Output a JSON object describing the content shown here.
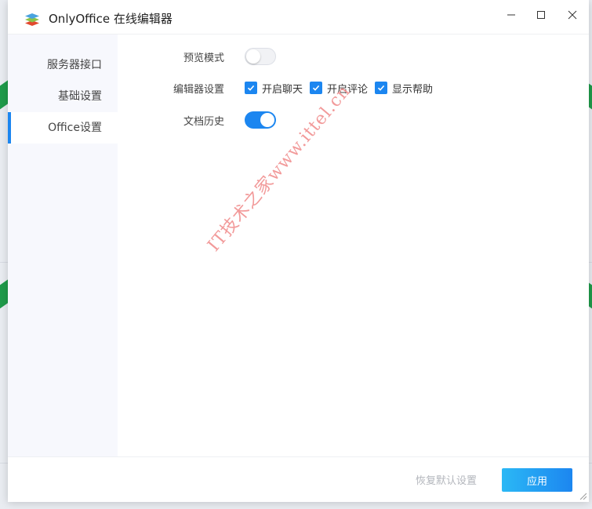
{
  "window": {
    "title": "OnlyOffice 在线编辑器",
    "icons": {
      "logo": "onlyoffice-logo-icon",
      "minimize": "minimize-icon",
      "maximize": "maximize-icon",
      "close": "close-icon"
    }
  },
  "sidebar": {
    "items": [
      {
        "label": "服务器接口",
        "active": false
      },
      {
        "label": "基础设置",
        "active": false
      },
      {
        "label": "Office设置",
        "active": true
      }
    ]
  },
  "settings": {
    "preview_mode": {
      "label": "预览模式",
      "enabled": false
    },
    "editor_settings": {
      "label": "编辑器设置",
      "options": [
        {
          "label": "开启聊天",
          "checked": true
        },
        {
          "label": "开启评论",
          "checked": true
        },
        {
          "label": "显示帮助",
          "checked": true
        }
      ]
    },
    "doc_history": {
      "label": "文档历史",
      "enabled": true
    }
  },
  "watermark": {
    "text": "IT技术之家www.ittel.cn"
  },
  "footer": {
    "restore_label": "恢复默认设置",
    "apply_label": "应用"
  },
  "colors": {
    "accent": "#1c86f0",
    "accent_light": "#2bb8f5",
    "watermark": "#f29a9a",
    "sidebar_bg": "#f7f8fd"
  }
}
